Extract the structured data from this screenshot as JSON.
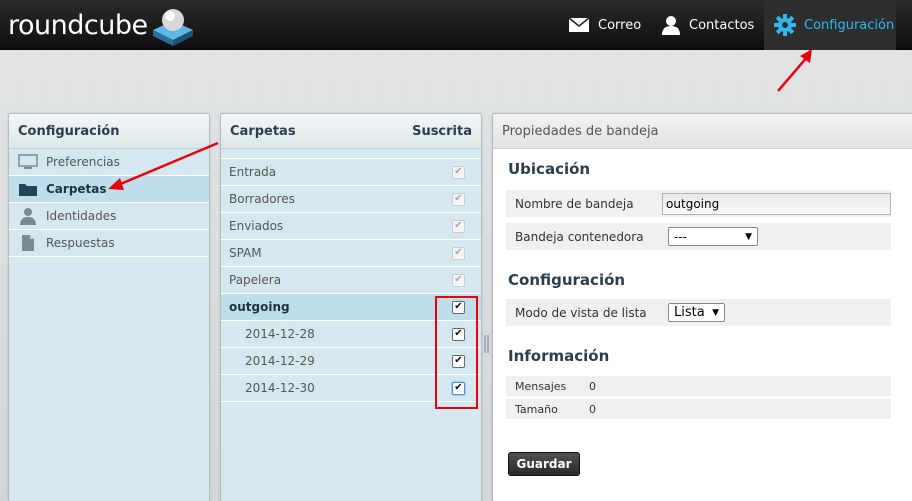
{
  "logo": {
    "text": "roundcube"
  },
  "nav": {
    "mail": "Correo",
    "contacts": "Contactos",
    "settings": "Configuración"
  },
  "sections_panel": {
    "title": "Configuración",
    "items": [
      {
        "label": "Preferencias",
        "icon": "monitor-icon"
      },
      {
        "label": "Carpetas",
        "icon": "folder-icon",
        "selected": true
      },
      {
        "label": "Identidades",
        "icon": "person-icon"
      },
      {
        "label": "Respuestas",
        "icon": "document-icon"
      }
    ]
  },
  "folders_panel": {
    "title": "Carpetas",
    "subscribed_header": "Suscrita",
    "folders": [
      {
        "name": "Entrada",
        "subscribed": true,
        "disabled": true
      },
      {
        "name": "Borradores",
        "subscribed": true,
        "disabled": true
      },
      {
        "name": "Enviados",
        "subscribed": true,
        "disabled": true
      },
      {
        "name": "SPAM",
        "subscribed": true,
        "disabled": true
      },
      {
        "name": "Papelera",
        "subscribed": true,
        "disabled": true
      },
      {
        "name": "outgoing",
        "subscribed": true,
        "selected": true
      },
      {
        "name": "2014-12-28",
        "subscribed": true,
        "child": true
      },
      {
        "name": "2014-12-29",
        "subscribed": true,
        "child": true
      },
      {
        "name": "2014-12-30",
        "subscribed": true,
        "child": true,
        "focused": true
      }
    ]
  },
  "properties": {
    "title": "Propiedades de bandeja",
    "location_heading": "Ubicación",
    "name_label": "Nombre de bandeja",
    "name_value": "outgoing",
    "parent_label": "Bandeja contenedora",
    "parent_value": "---",
    "config_heading": "Configuración",
    "view_mode_label": "Modo de vista de lista",
    "view_mode_value": "Lista",
    "info_heading": "Información",
    "messages_label": "Mensajes",
    "messages_value": "0",
    "size_label": "Tamaño",
    "size_value": "0",
    "save_label": "Guardar"
  },
  "colors": {
    "accent": "#30b8f3",
    "annotation_red": "#e3000f",
    "selected_row": "#bfdeea"
  }
}
